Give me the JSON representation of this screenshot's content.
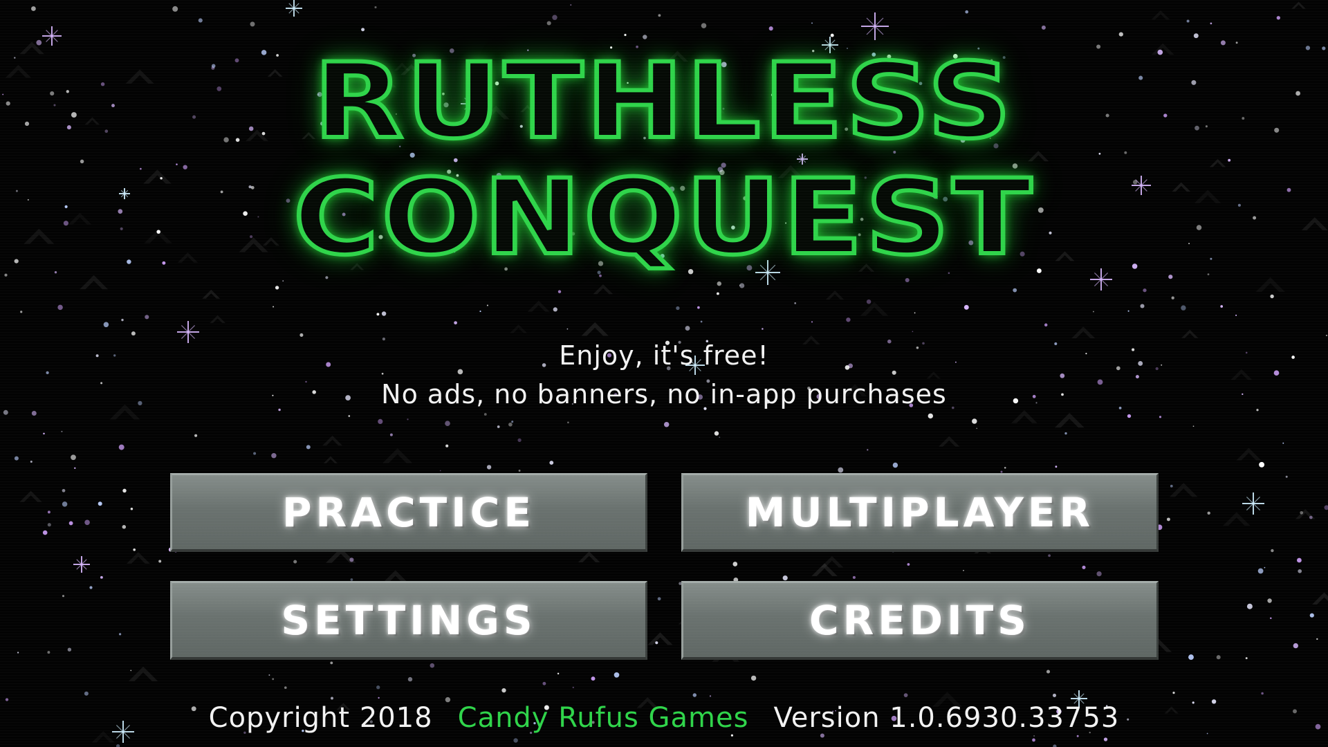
{
  "title": {
    "line1": "RUTHLESS",
    "line2": "CONQUEST"
  },
  "tagline": {
    "line1": "Enjoy, it's free!",
    "line2": "No ads, no banners, no in-app purchases"
  },
  "menu": {
    "practice_label": "PRACTICE",
    "multiplayer_label": "MULTIPLAYER",
    "settings_label": "SETTINGS",
    "credits_label": "CREDITS"
  },
  "footer": {
    "copyright": "Copyright 2018",
    "company": "Candy Rufus Games",
    "version": "Version 1.0.6930.33753"
  },
  "colors": {
    "title_glow": "#2fd44a",
    "company_link": "#2fd44a",
    "button_face": "#6f7774",
    "text": "#f2f2f2",
    "background": "#030303"
  }
}
